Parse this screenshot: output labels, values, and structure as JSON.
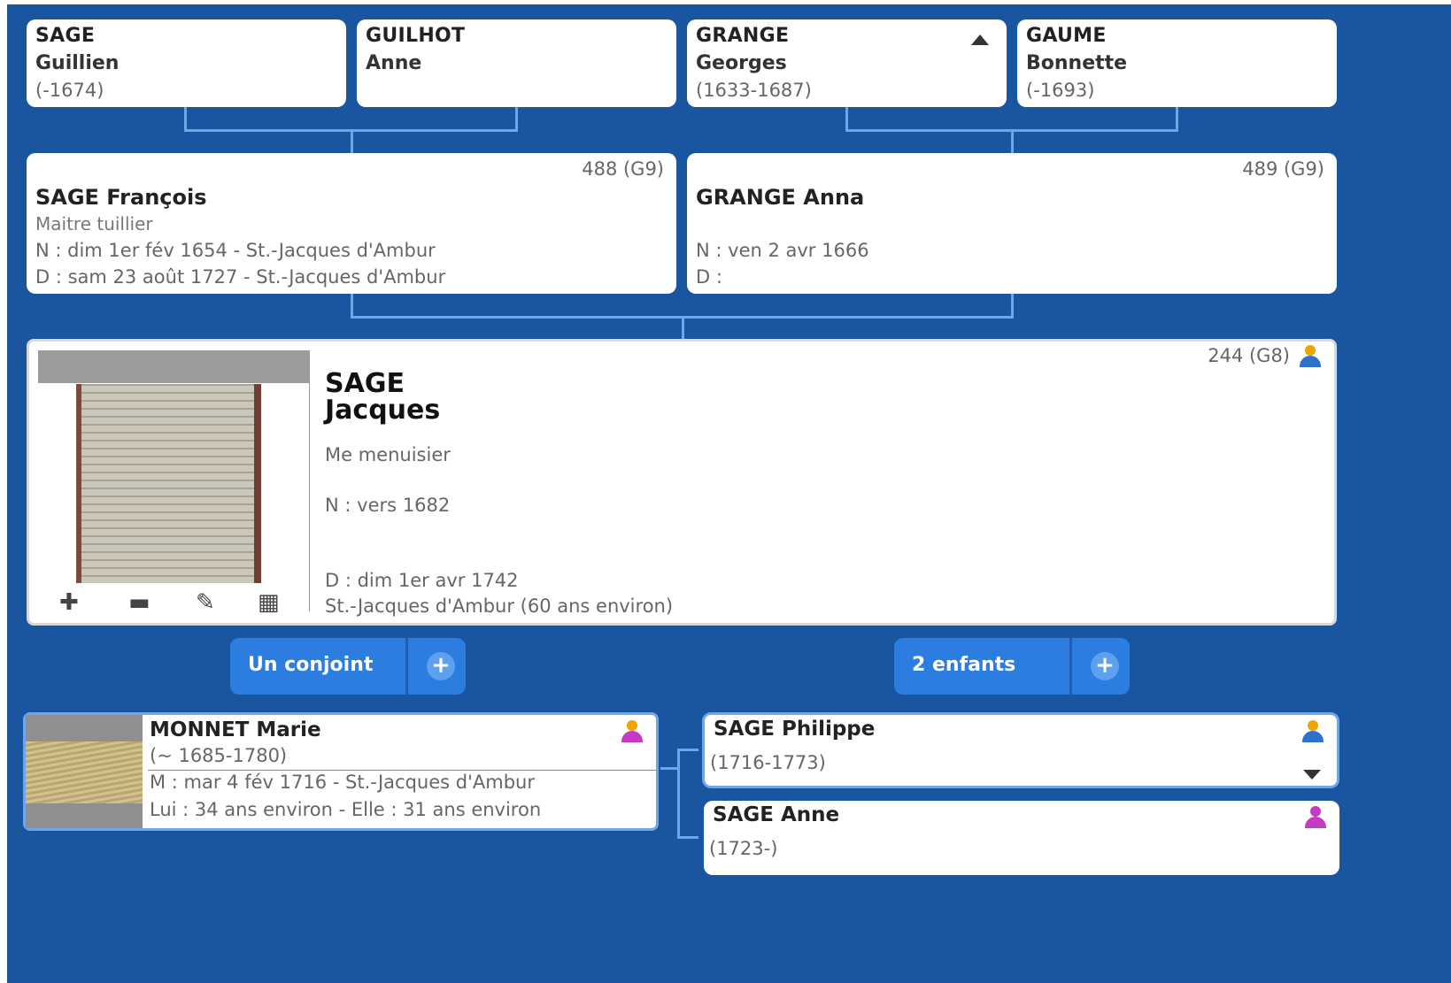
{
  "grandparents": [
    {
      "last": "SAGE",
      "first": "Guillien",
      "dates": "(-1674)"
    },
    {
      "last": "GUILHOT",
      "first": "Anne",
      "dates": ""
    },
    {
      "last": "GRANGE",
      "first": "Georges",
      "dates": "(1633-1687)",
      "icon": "caret-up-icon"
    },
    {
      "last": "GAUME",
      "first": "Bonnette",
      "dates": "(-1693)"
    }
  ],
  "parents": [
    {
      "number": "488 (G9)",
      "name": "SAGE François",
      "occupation": "Maitre tuillier",
      "birth": "N : dim 1er fév 1654 - St.-Jacques d'Ambur",
      "death": "D : sam 23 août 1727 - St.-Jacques d'Ambur"
    },
    {
      "number": "489 (G9)",
      "name": "GRANGE Anna",
      "occupation": "",
      "birth": "N : ven 2 avr 1666",
      "death": "D :"
    }
  ],
  "main": {
    "number": "244 (G8)",
    "last": "SAGE",
    "first": "Jacques",
    "occupation": "Me menuisier",
    "birth": "N : vers 1682",
    "death": "D : dim 1er avr 1742",
    "death_place": "St.-Jacques d'Ambur (60 ans environ)",
    "tools": [
      "plus-icon",
      "minus-icon",
      "pencil-icon",
      "film-icon"
    ],
    "tool_glyphs": [
      "✚",
      "▬",
      "✎",
      "▦"
    ]
  },
  "buttons": {
    "spouse_label": "Un conjoint",
    "children_label": "2 enfants",
    "plus_glyph": "+"
  },
  "spouse": {
    "name": "MONNET Marie",
    "dates": "(~ 1685-1780)",
    "marriage": "M : mar 4 fév 1716 - St.-Jacques d'Ambur",
    "ages": "Lui : 34 ans environ - Elle : 31 ans environ"
  },
  "children": [
    {
      "name": "SAGE Philippe",
      "dates": "(1716-1773)",
      "sex": "male"
    },
    {
      "name": "SAGE Anne",
      "dates": "(1723-)",
      "sex": "female"
    }
  ],
  "colors": {
    "background": "#1a55a0",
    "connector": "#6ea6ea",
    "button": "#2b7de0",
    "male": "#f0a400",
    "male_body": "#2e73c9",
    "female": "#c43ac4"
  }
}
